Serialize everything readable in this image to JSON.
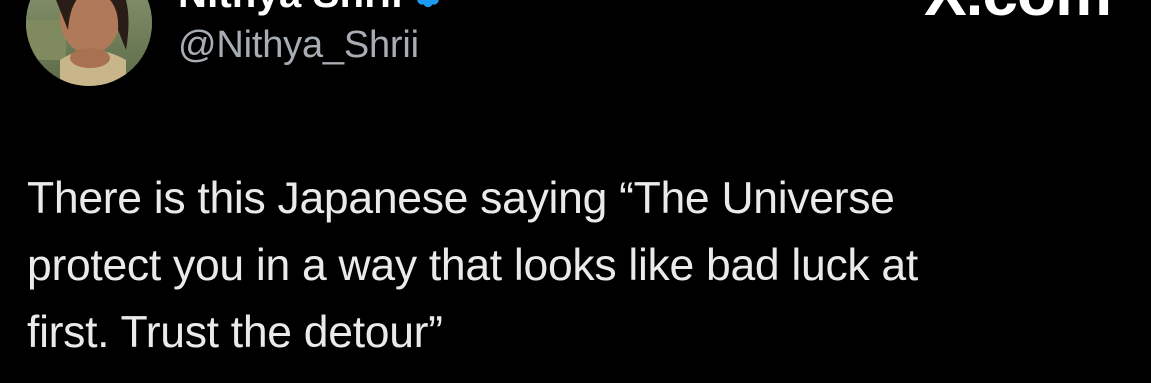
{
  "author": {
    "display_name": "Nithya Shrii",
    "handle": "@Nithya_Shrii",
    "verified": true,
    "verified_color": "#1d9bf0"
  },
  "site_mark": "X.com",
  "tweet": {
    "lines": [
      "There is this Japanese saying “The Universe",
      "protect you in a way that looks like bad luck at",
      "first. Trust the detour”"
    ]
  },
  "colors": {
    "background": "#000000",
    "text": "#e9eaeb",
    "handle": "#a7adb3"
  },
  "icons": [
    "avatar",
    "verified-badge-icon"
  ]
}
